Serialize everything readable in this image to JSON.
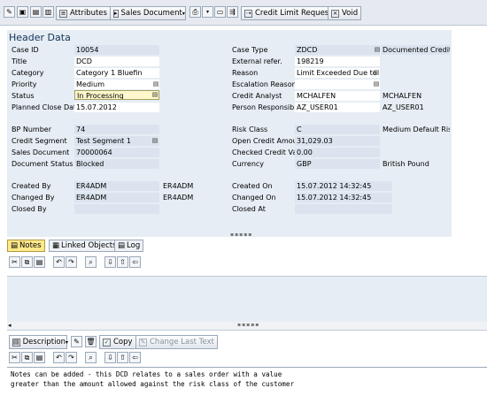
{
  "toolbar": {
    "attributes_label": "Attributes",
    "sales_document_label": "Sales Document",
    "credit_limit_request_label": "Credit Limit Request",
    "void_label": "Void"
  },
  "header": {
    "title": "Header Data",
    "fields": {
      "case_id": {
        "label": "Case ID",
        "value": "10054"
      },
      "title": {
        "label": "Title",
        "value": "DCD"
      },
      "category": {
        "label": "Category",
        "value": "Category 1 Bluefin"
      },
      "priority": {
        "label": "Priority",
        "value": "Medium"
      },
      "status": {
        "label": "Status",
        "value": "In Processing"
      },
      "planned_close_date": {
        "label": "Planned Close Date",
        "value": "15.07.2012"
      },
      "case_type": {
        "label": "Case Type",
        "value": "ZDCD",
        "desc": "Documented Credit I"
      },
      "external_ref": {
        "label": "External refer.",
        "value": "198219"
      },
      "reason": {
        "label": "Reason",
        "value": "Limit Exceeded Due to"
      },
      "escalation_reason": {
        "label": "Escalation Reason",
        "value": ""
      },
      "credit_analyst": {
        "label": "Credit Analyst",
        "value": "MCHALFEN",
        "desc": "MCHALFEN"
      },
      "person_responsible": {
        "label": "Person Responsible",
        "value": "AZ_USER01",
        "desc": "AZ_USER01"
      },
      "bp_number": {
        "label": "BP Number",
        "value": "74"
      },
      "credit_segment": {
        "label": "Credit Segment",
        "value": "Test Segment 1"
      },
      "sales_document": {
        "label": "Sales Document",
        "value": "70000064"
      },
      "document_status": {
        "label": "Document Status",
        "value": "Blocked"
      },
      "risk_class": {
        "label": "Risk Class",
        "value": "C",
        "desc": "Medium Default Risk"
      },
      "open_credit_amount": {
        "label": "Open Credit Amour",
        "value": "31,029.03"
      },
      "checked_credit_value": {
        "label": "Checked Credit Valu",
        "value": "0.00"
      },
      "currency": {
        "label": "Currency",
        "value": "GBP",
        "desc": "British Pound"
      },
      "created_by": {
        "label": "Created By",
        "value": "ER4ADM",
        "desc": "ER4ADM"
      },
      "changed_by": {
        "label": "Changed By",
        "value": "ER4ADM",
        "desc": "ER4ADM"
      },
      "closed_by": {
        "label": "Closed By",
        "value": ""
      },
      "created_on": {
        "label": "Created On",
        "value": "15.07.2012 14:32:45"
      },
      "changed_on": {
        "label": "Changed On",
        "value": "15.07.2012 14:32:45"
      },
      "closed_at": {
        "label": "Closed At",
        "value": ""
      }
    }
  },
  "tabs": [
    {
      "label": "Notes",
      "active": true
    },
    {
      "label": "Linked Objects",
      "active": false
    },
    {
      "label": "Log",
      "active": false
    }
  ],
  "notes_toolbar": {
    "description_label": "Description",
    "copy_label": "Copy",
    "change_last_text_label": "Change Last Text"
  },
  "note_text": {
    "line1": "Notes can be added - this DCD relates to a sales order with a value",
    "line2": "greater than the amount allowed against the risk class of the customer"
  },
  "colors": {
    "accent": "#ffe98a",
    "panel": "#e6edf4",
    "toolbar": "#e6eaf0"
  }
}
